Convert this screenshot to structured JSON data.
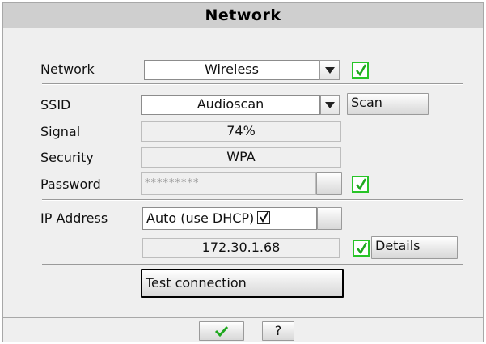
{
  "dialog": {
    "title": "Network"
  },
  "network": {
    "label": "Network",
    "value": "Wireless",
    "enabled": true
  },
  "ssid": {
    "label": "SSID",
    "value": "Audioscan",
    "scan_label": "Scan"
  },
  "signal": {
    "label": "Signal",
    "value": "74%"
  },
  "security": {
    "label": "Security",
    "value": "WPA"
  },
  "password": {
    "label": "Password",
    "value": "*********",
    "show": true
  },
  "ip": {
    "label": "IP Address",
    "mode": "Auto (use DHCP)",
    "dhcp_checked": true,
    "address": "172.30.1.68",
    "details_checked": true,
    "details_label": "Details"
  },
  "test": {
    "label": "Test connection"
  },
  "footer": {
    "ok_icon": "green-checkmark-icon",
    "help_label": "?"
  },
  "colors": {
    "accent_green": "#27c427",
    "check_green": "#1fa81f"
  }
}
